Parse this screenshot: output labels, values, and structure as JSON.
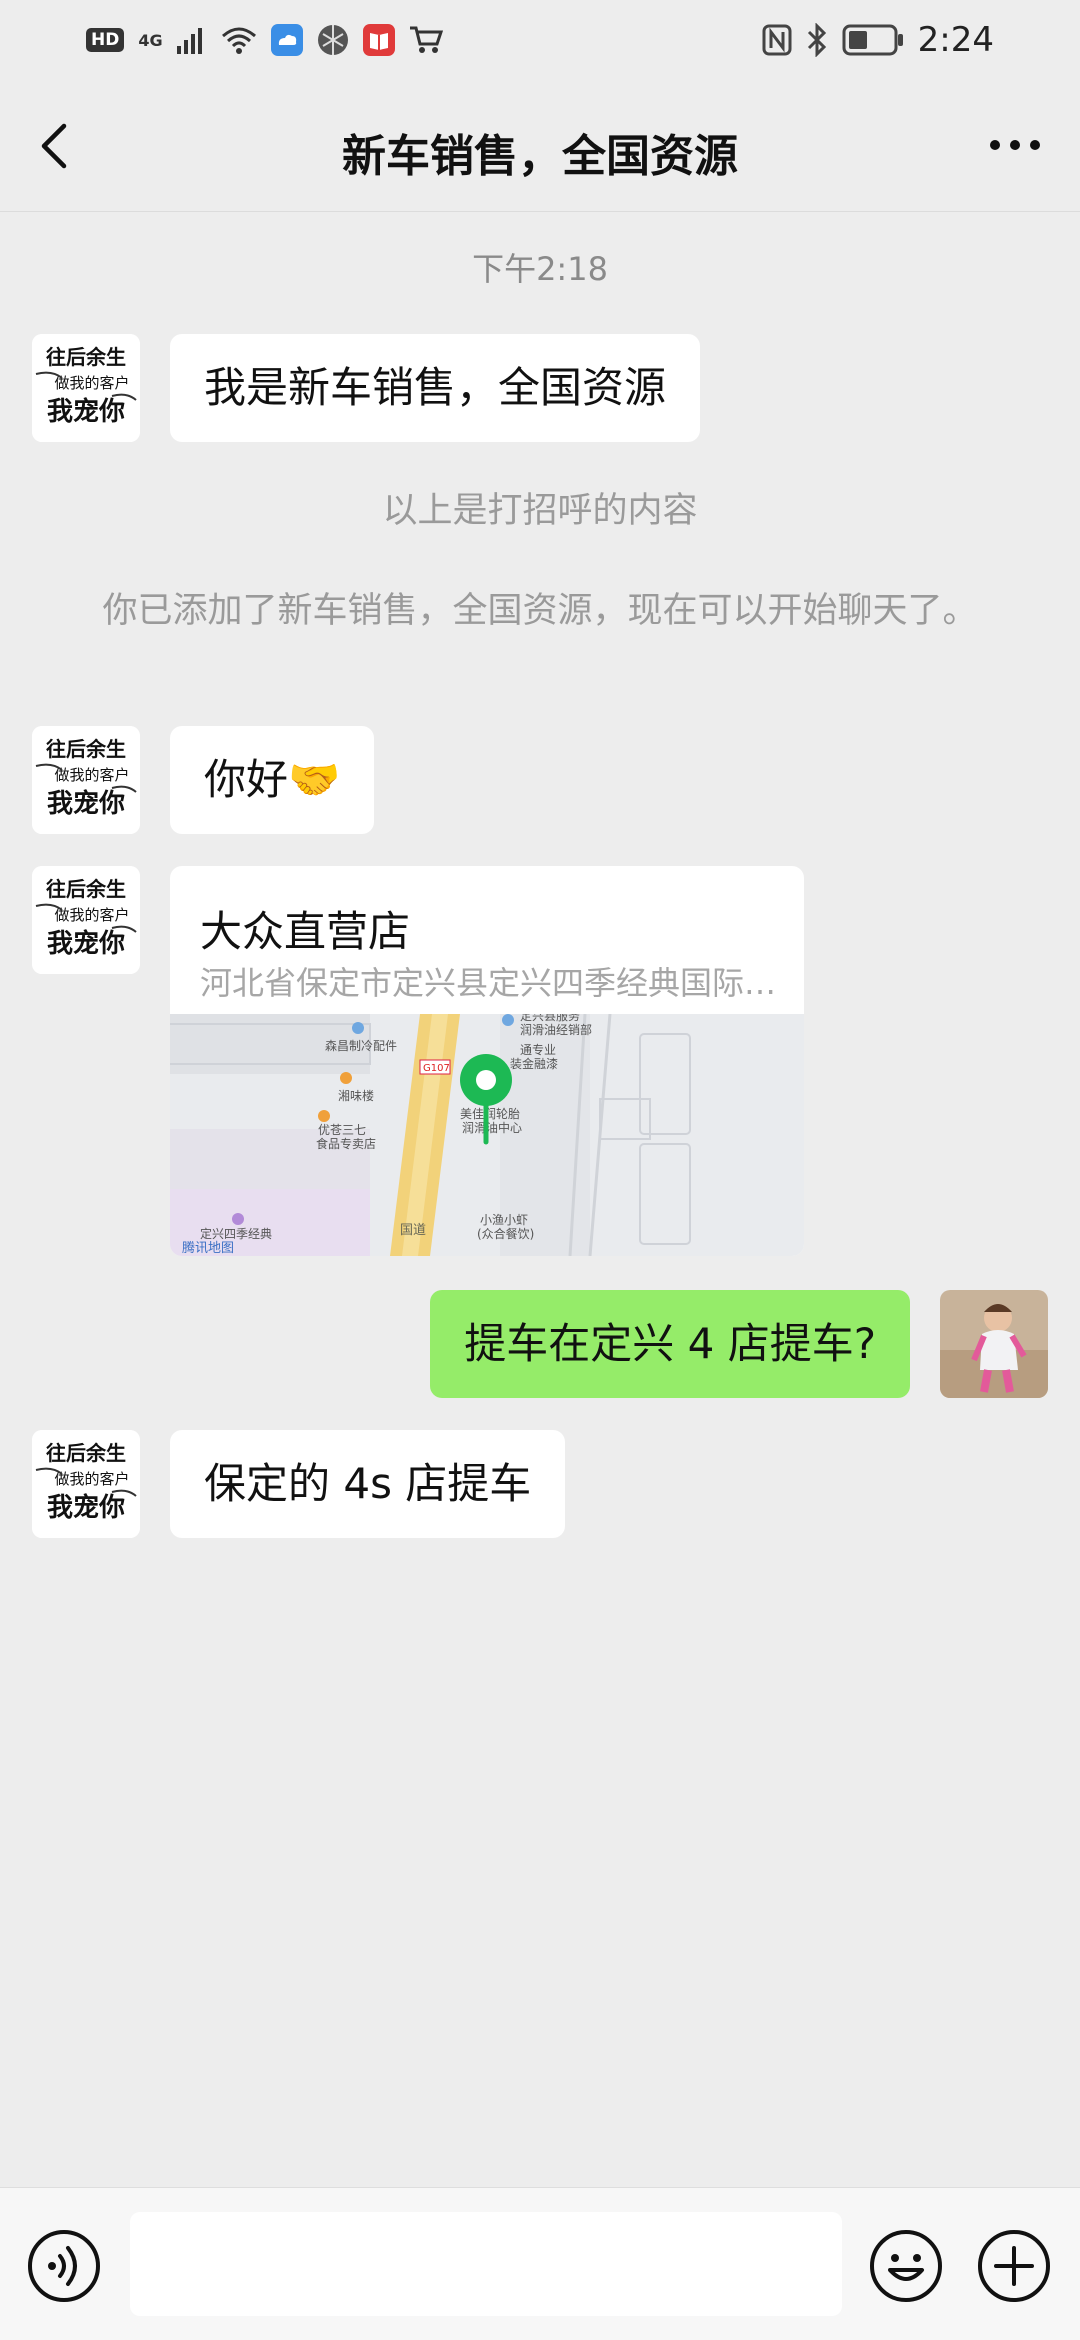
{
  "status_bar": {
    "hd": "HD",
    "network": "4G",
    "time": "2:24"
  },
  "nav": {
    "title": "新车销售，全国资源"
  },
  "chat": {
    "timestamp": "下午2:18",
    "messages": [
      {
        "type": "text",
        "side": "left",
        "text": "我是新车销售，全国资源"
      },
      {
        "type": "system",
        "text": "以上是打招呼的内容"
      },
      {
        "type": "system",
        "text": "你已添加了新车销售，全国资源，现在可以开始聊天了。"
      },
      {
        "type": "text",
        "side": "left",
        "text": "你好🤝"
      },
      {
        "type": "location",
        "side": "left",
        "title": "大众直营店",
        "address": "河北省保定市定兴县定兴四季经典国际…"
      },
      {
        "type": "text",
        "side": "right",
        "text": "提车在定兴 4 店提车?"
      },
      {
        "type": "text",
        "side": "left",
        "text": "保定的 4s 店提车"
      }
    ]
  },
  "map": {
    "labels": [
      "森昌制冷配件",
      "湘味楼",
      "优苍三七",
      "食品专卖店",
      "定兴四季经典",
      "腾讯地图",
      "G107",
      "国道",
      "定兴县服务",
      "润滑油经销部",
      "通专业",
      "装金融漆",
      "美佳润轮胎",
      "润滑油中心",
      "小渔小虾",
      "(众合餐饮)"
    ]
  },
  "avatar_left": {
    "lines": [
      "往后余生",
      "做我的客户",
      "我宠你"
    ]
  },
  "colors": {
    "background": "#ededed",
    "bubble_green": "#95ec69",
    "bubble_white": "#ffffff",
    "map_pin": "#1db954"
  }
}
